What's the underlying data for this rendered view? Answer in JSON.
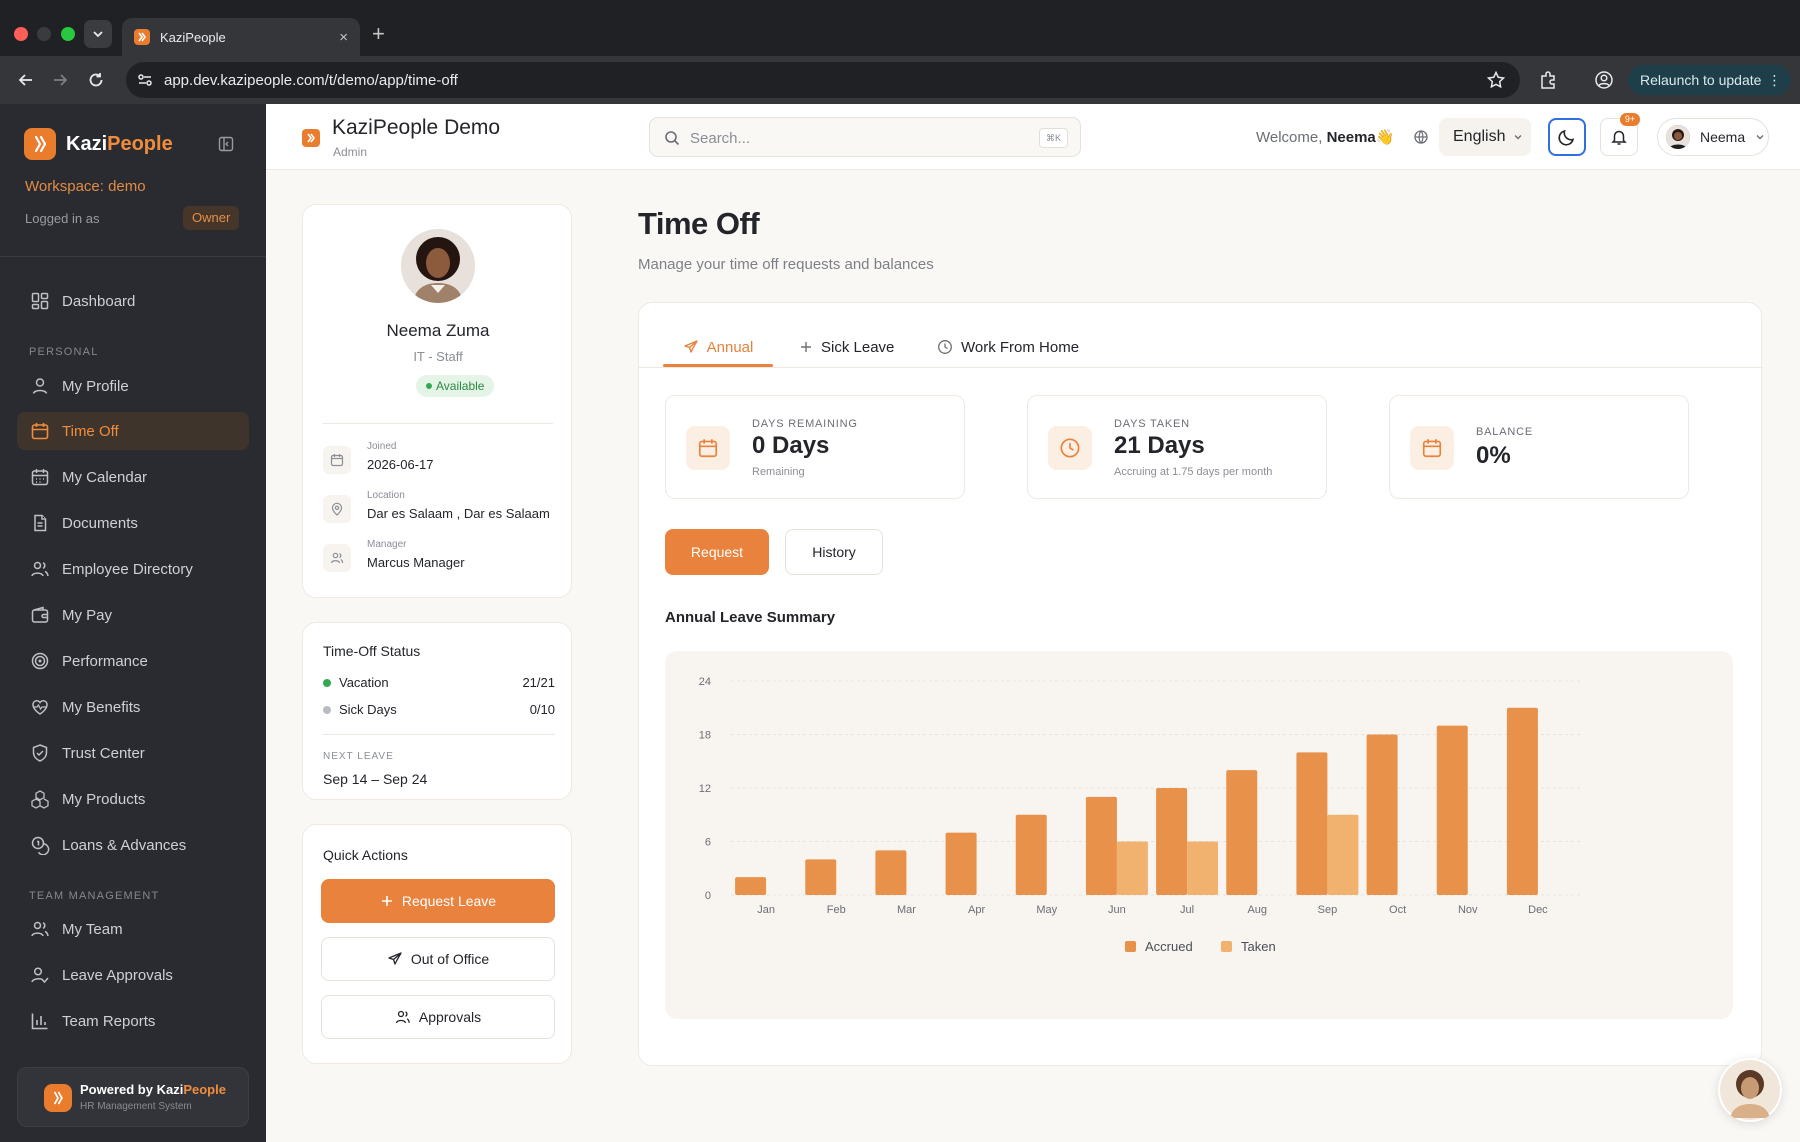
{
  "browser": {
    "tab_title": "KaziPeople",
    "tab_close": "×",
    "new_tab": "+",
    "url": "app.dev.kazipeople.com/t/demo/app/time-off",
    "relaunch_label": "Relaunch to update",
    "relaunch_menu": "⋮"
  },
  "sidebar": {
    "brand_part1": "Kazi",
    "brand_part2": "People",
    "workspace": "Workspace: demo",
    "logged_in": "Logged in as",
    "role": "Owner",
    "section_personal": "PERSONAL",
    "section_team": "TEAM MANAGEMENT",
    "items": [
      {
        "label": "Dashboard",
        "icon": "dashboard-icon"
      },
      {
        "label": "My Profile",
        "icon": "user-icon"
      },
      {
        "label": "Time Off",
        "icon": "calendar-icon",
        "active": true
      },
      {
        "label": "My Calendar",
        "icon": "calendar-grid-icon"
      },
      {
        "label": "Documents",
        "icon": "document-icon"
      },
      {
        "label": "Employee Directory",
        "icon": "users-icon"
      },
      {
        "label": "My Pay",
        "icon": "wallet-icon"
      },
      {
        "label": "Performance",
        "icon": "target-icon"
      },
      {
        "label": "My Benefits",
        "icon": "heart-icon"
      },
      {
        "label": "Trust Center",
        "icon": "shield-icon"
      },
      {
        "label": "My Products",
        "icon": "boxes-icon"
      },
      {
        "label": "Loans & Advances",
        "icon": "coins-icon"
      }
    ],
    "team_items": [
      {
        "label": "My Team",
        "icon": "users-icon"
      },
      {
        "label": "Leave Approvals",
        "icon": "user-check-icon"
      },
      {
        "label": "Team Reports",
        "icon": "bar-chart-icon"
      }
    ],
    "powered_prefix": "Powered by ",
    "powered_brand1": "Kazi",
    "powered_brand2": "People",
    "powered_sub": "HR Management System"
  },
  "header": {
    "title": "KaziPeople Demo",
    "role": "Admin",
    "search_placeholder": "Search...",
    "search_shortcut": "⌘K",
    "welcome_prefix": "Welcome, ",
    "welcome_name": "Neema",
    "welcome_emoji": "👋",
    "language": "English",
    "notification_count": "9+",
    "user_name": "Neema"
  },
  "profile": {
    "name": "Neema Zuma",
    "department": "IT - Staff",
    "status": "Available",
    "joined_label": "Joined",
    "joined_value": "2026-06-17",
    "location_label": "Location",
    "location_value": "Dar es Salaam , Dar es Salaam",
    "manager_label": "Manager",
    "manager_value": "Marcus Manager"
  },
  "time_off_status": {
    "title": "Time-Off Status",
    "rows": [
      {
        "name": "Vacation",
        "count": "21/21",
        "color": "#35a853"
      },
      {
        "name": "Sick Days",
        "count": "0/10",
        "color": "#b8bbc2"
      }
    ],
    "next_leave_label": "NEXT LEAVE",
    "next_leave_value": "Sep 14 – Sep 24"
  },
  "quick_actions": {
    "title": "Quick Actions",
    "request_leave": "Request Leave",
    "out_of_office": "Out of Office",
    "approvals": "Approvals"
  },
  "page": {
    "title": "Time Off",
    "subtitle": "Manage your time off requests and balances"
  },
  "leave_tabs": [
    {
      "label": "Annual",
      "icon": "plane-icon",
      "active": true
    },
    {
      "label": "Sick Leave",
      "icon": "plus-icon"
    },
    {
      "label": "Work From Home",
      "icon": "clock-icon"
    }
  ],
  "stats": {
    "remaining": {
      "label": "DAYS REMAINING",
      "value": "0 Days",
      "sub": "Remaining"
    },
    "taken": {
      "label": "DAYS TAKEN",
      "value": "21 Days",
      "sub": "Accruing at 1.75 days per month"
    },
    "balance": {
      "label": "BALANCE",
      "value": "0%"
    }
  },
  "actions": {
    "request": "Request",
    "history": "History"
  },
  "summary_title": "Annual Leave Summary",
  "colors": {
    "accent": "#e8823c",
    "accrued": "#e8914a",
    "taken": "#f0b26e"
  },
  "chart_data": {
    "type": "bar",
    "categories": [
      "Jan",
      "Feb",
      "Mar",
      "Apr",
      "May",
      "Jun",
      "Jul",
      "Aug",
      "Sep",
      "Oct",
      "Nov",
      "Dec"
    ],
    "series": [
      {
        "name": "Accrued",
        "values": [
          2,
          4,
          5,
          7,
          9,
          11,
          12,
          14,
          16,
          18,
          19,
          21
        ]
      },
      {
        "name": "Taken",
        "values": [
          0,
          0,
          0,
          0,
          0,
          6,
          6,
          0,
          9,
          0,
          0,
          0
        ]
      }
    ],
    "yticks": [
      0,
      6,
      12,
      18,
      24
    ],
    "ylim": [
      0,
      24
    ],
    "grid": true,
    "legend": "bottom-center"
  }
}
